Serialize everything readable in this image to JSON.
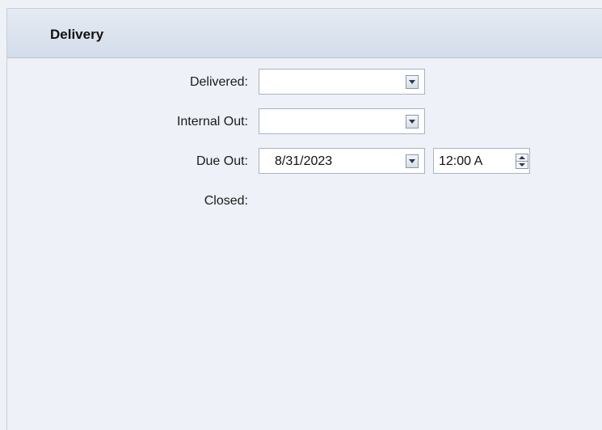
{
  "panel": {
    "title": "Delivery"
  },
  "fields": {
    "delivered": {
      "label": "Delivered:",
      "value": ""
    },
    "internal_out": {
      "label": "Internal Out:",
      "value": ""
    },
    "due_out": {
      "label": "Due Out:",
      "date": "8/31/2023",
      "time": "12:00 A"
    },
    "closed": {
      "label": "Closed:"
    }
  },
  "icons": {
    "dropdown": "chevron-down-icon",
    "spin_up": "spin-up-icon",
    "spin_down": "spin-down-icon"
  }
}
